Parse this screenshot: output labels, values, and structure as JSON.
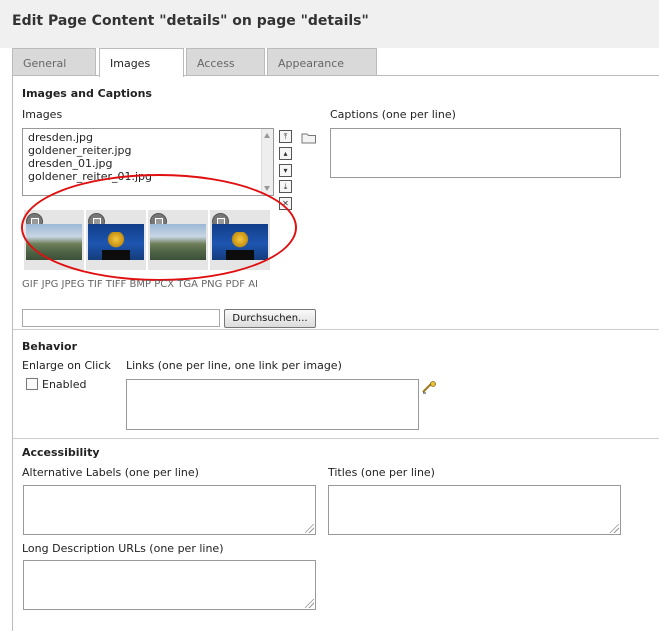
{
  "page": {
    "title": "Edit Page Content \"details\" on page \"details\""
  },
  "tabs": [
    {
      "label": "General",
      "active": false
    },
    {
      "label": "Images",
      "active": true
    },
    {
      "label": "Access",
      "active": false
    },
    {
      "label": "Appearance",
      "active": false
    }
  ],
  "images_section": {
    "heading": "Images and Captions",
    "images_label": "Images",
    "files": [
      "dresden.jpg",
      "goldener_reiter.jpg",
      "dresden_01.jpg",
      "goldener_reiter_01.jpg"
    ],
    "captions_label": "Captions (one per line)",
    "captions_value": "",
    "thumbnails": [
      {
        "name": "dresden-thumbnail",
        "kind": "dresden"
      },
      {
        "name": "goldener-reiter-thumbnail",
        "kind": "reiter"
      },
      {
        "name": "dresden-thumbnail",
        "kind": "dresden"
      },
      {
        "name": "goldener-reiter-thumbnail",
        "kind": "reiter"
      }
    ],
    "allowed_types": "GIF JPG JPEG TIF TIFF BMP PCX TGA PNG PDF AI",
    "upload_value": "",
    "browse_label": "Durchsuchen..."
  },
  "behavior_section": {
    "heading": "Behavior",
    "enlarge_label": "Enlarge on Click",
    "enabled_label": "Enabled",
    "enabled_checked": false,
    "links_label": "Links (one per line, one link per image)",
    "links_value": ""
  },
  "accessibility_section": {
    "heading": "Accessibility",
    "alt_label": "Alternative Labels (one per line)",
    "titles_label": "Titles (one per line)",
    "longdesc_label": "Long Description URLs (one per line)"
  },
  "colors": {
    "annotation": "#e01010",
    "tab_inactive": "#d9d9d9",
    "header_bg": "#f0f0f0"
  }
}
